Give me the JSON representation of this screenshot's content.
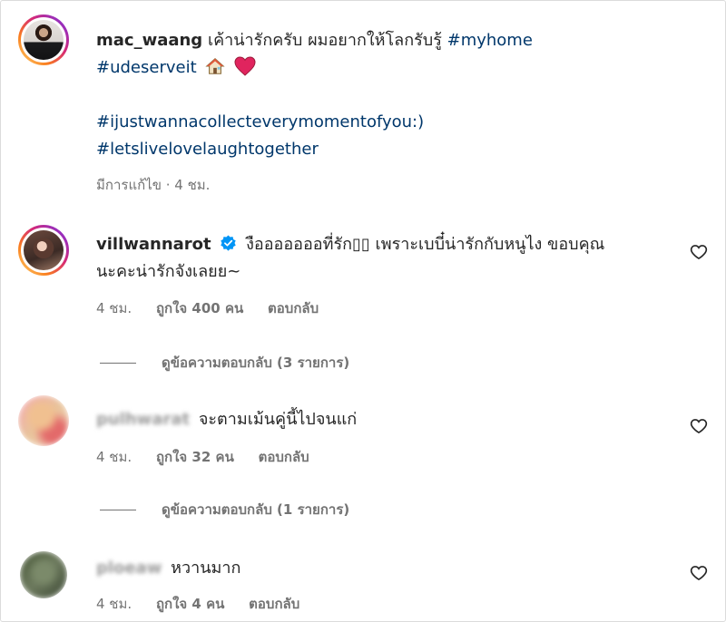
{
  "post": {
    "username": "mac_waang",
    "caption": "เค้าน่ารักครับ ผมอยากให้โลกรับรู้",
    "hashtags_line1": "#myhome",
    "hashtags_line2": "#udeserveit",
    "emoji_house": "🏠",
    "emoji_heart": "❤",
    "hashtags_line3": "#ijustwannacollecteverymomentofyou:)",
    "hashtags_line4": "#letslivelovelaughtogether",
    "meta": "มีการแก้ไข · 4 ชม."
  },
  "comments": [
    {
      "username": "villwannarot",
      "verified": true,
      "text_line1": "งือออออออที่รัก▯▯ เพราะเบบี๋น่ารักกับหนูไง ขอบคุณ",
      "text_line2": "นะคะน่ารักจังเลยย~",
      "time": "4 ชม.",
      "likes": "ถูกใจ 400 คน",
      "reply_label": "ตอบกลับ",
      "view_replies": "ดูข้อความตอบกลับ (3 รายการ)"
    },
    {
      "username": "pulhwarat",
      "text": "จะตามเม้นคู่นี้ไปจนแก่",
      "time": "4 ชม.",
      "likes": "ถูกใจ 32 คน",
      "reply_label": "ตอบกลับ",
      "view_replies": "ดูข้อความตอบกลับ (1 รายการ)"
    },
    {
      "username": "ploeaw",
      "text": "หวานมาก",
      "time": "4 ชม.",
      "likes": "ถูกใจ 4 คน",
      "reply_label": "ตอบกลับ"
    }
  ],
  "icons": {
    "like": "heart-outline-icon",
    "verified": "verified-badge-icon"
  },
  "colors": {
    "hashtag": "#00376b",
    "verified": "#0095f6",
    "muted": "#737373"
  }
}
